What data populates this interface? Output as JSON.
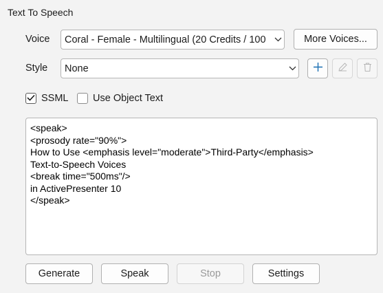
{
  "panel_title": "Text To Speech",
  "voice": {
    "label": "Voice",
    "selected": "Coral - Female - Multilingual (20 Credits / 100",
    "more_button": "More Voices..."
  },
  "style": {
    "label": "Style",
    "selected": "None"
  },
  "options": {
    "ssml_label": "SSML",
    "ssml_checked": true,
    "object_text_label": "Use Object Text",
    "object_text_checked": false
  },
  "editor": {
    "lines": [
      "<speak>",
      "<prosody rate=\"90%\">",
      "How to Use <emphasis level=\"moderate\">Third-Party</emphasis>",
      "Text-to-Speech Voices",
      "<break time=\"500ms\"/>",
      "in ActivePresenter 10",
      "</speak>"
    ]
  },
  "buttons": {
    "generate": "Generate",
    "speak": "Speak",
    "stop": "Stop",
    "settings": "Settings"
  },
  "icons": {
    "add": "plus-icon",
    "edit": "pencil-icon",
    "delete": "trash-icon",
    "chevron": "chevron-down-icon",
    "check": "checkmark-icon"
  }
}
